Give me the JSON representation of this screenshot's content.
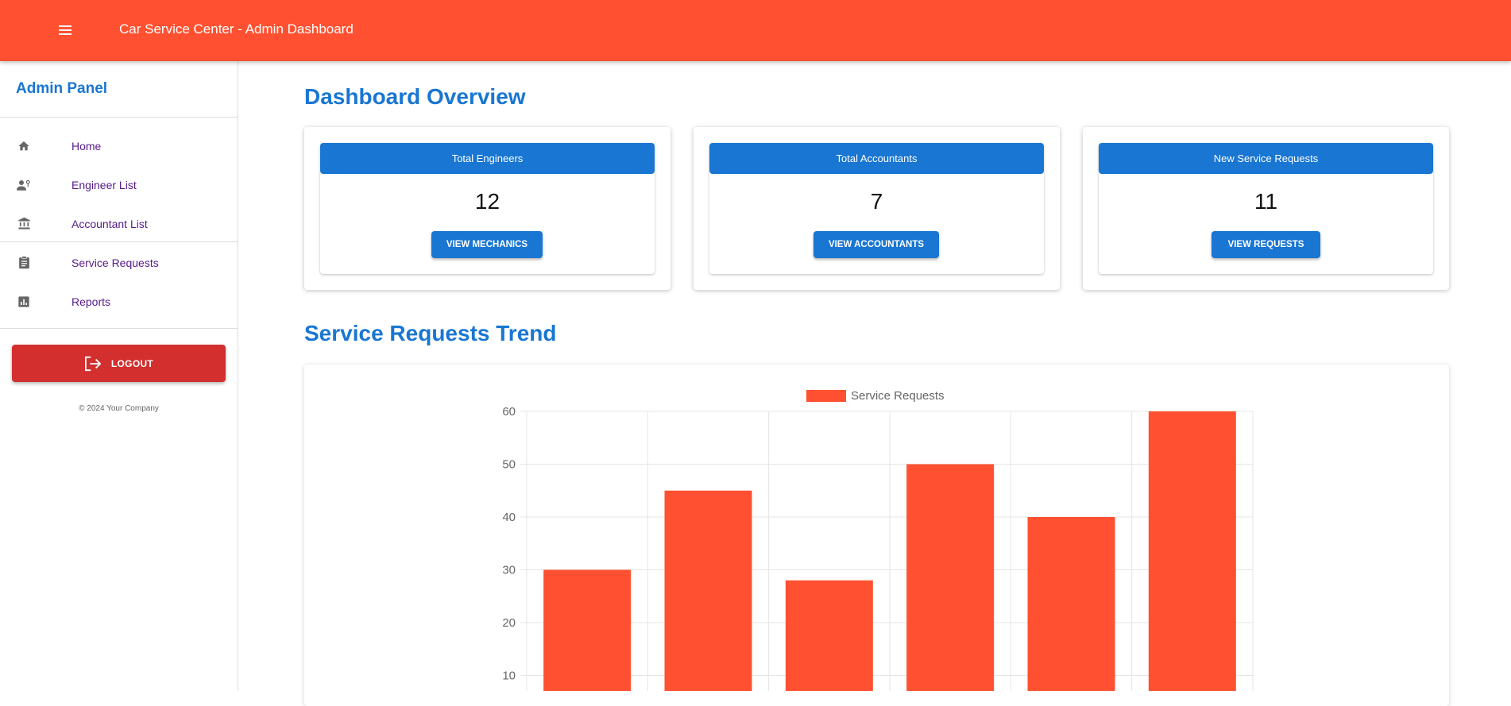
{
  "header": {
    "title": "Car Service Center - Admin Dashboard",
    "menu_icon": "hamburger-menu-icon"
  },
  "sidebar": {
    "title": "Admin Panel",
    "items": [
      {
        "label": "Home",
        "icon": "home-icon"
      },
      {
        "label": "Engineer List",
        "icon": "engineer-icon"
      },
      {
        "label": "Accountant List",
        "icon": "bank-icon"
      },
      {
        "label": "Service Requests",
        "icon": "clipboard-icon"
      },
      {
        "label": "Reports",
        "icon": "bar-chart-icon"
      }
    ],
    "logout_label": "LOGOUT",
    "copyright": "© 2024 Your Company"
  },
  "main": {
    "overview_title": "Dashboard Overview",
    "cards": [
      {
        "title": "Total Engineers",
        "value": "12",
        "button": "VIEW MECHANICS"
      },
      {
        "title": "Total Accountants",
        "value": "7",
        "button": "VIEW ACCOUNTANTS"
      },
      {
        "title": "New Service Requests",
        "value": "11",
        "button": "VIEW REQUESTS"
      }
    ],
    "trend_title": "Service Requests Trend"
  },
  "colors": {
    "primary": "#1976d2",
    "accent": "#ff5131",
    "danger": "#d32f2f",
    "link": "#551a8b"
  },
  "chart_data": {
    "type": "bar",
    "categories": [
      "",
      "",
      "",
      "",
      "",
      ""
    ],
    "series": [
      {
        "name": "Service Requests",
        "values": [
          30,
          45,
          28,
          50,
          40,
          60
        ],
        "color": "#ff5131"
      }
    ],
    "y_ticks": [
      "60",
      "50",
      "40",
      "30",
      "20",
      "10"
    ],
    "ylim": [
      0,
      60
    ],
    "grid": true,
    "legend": "top-center"
  }
}
